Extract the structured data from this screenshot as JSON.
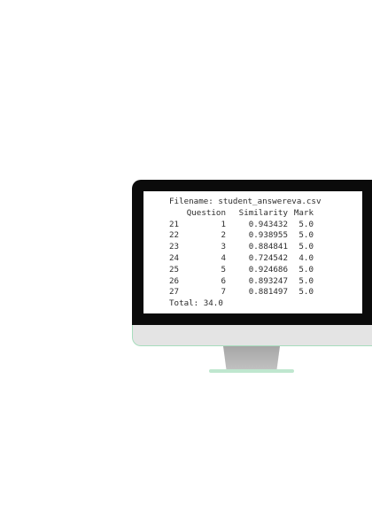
{
  "output": {
    "filename_label": "Filename: student_answereva.csv",
    "headers": {
      "question": "Question",
      "similarity": "Similarity",
      "mark": "Mark"
    },
    "rows": [
      {
        "index": "21",
        "question": "1",
        "similarity": "0.943432",
        "mark": "5.0"
      },
      {
        "index": "22",
        "question": "2",
        "similarity": "0.938955",
        "mark": "5.0"
      },
      {
        "index": "23",
        "question": "3",
        "similarity": "0.884841",
        "mark": "5.0"
      },
      {
        "index": "24",
        "question": "4",
        "similarity": "0.724542",
        "mark": "4.0"
      },
      {
        "index": "25",
        "question": "5",
        "similarity": "0.924686",
        "mark": "5.0"
      },
      {
        "index": "26",
        "question": "6",
        "similarity": "0.893247",
        "mark": "5.0"
      },
      {
        "index": "27",
        "question": "7",
        "similarity": "0.881497",
        "mark": "5.0"
      }
    ],
    "total": "Total: 34.0"
  }
}
